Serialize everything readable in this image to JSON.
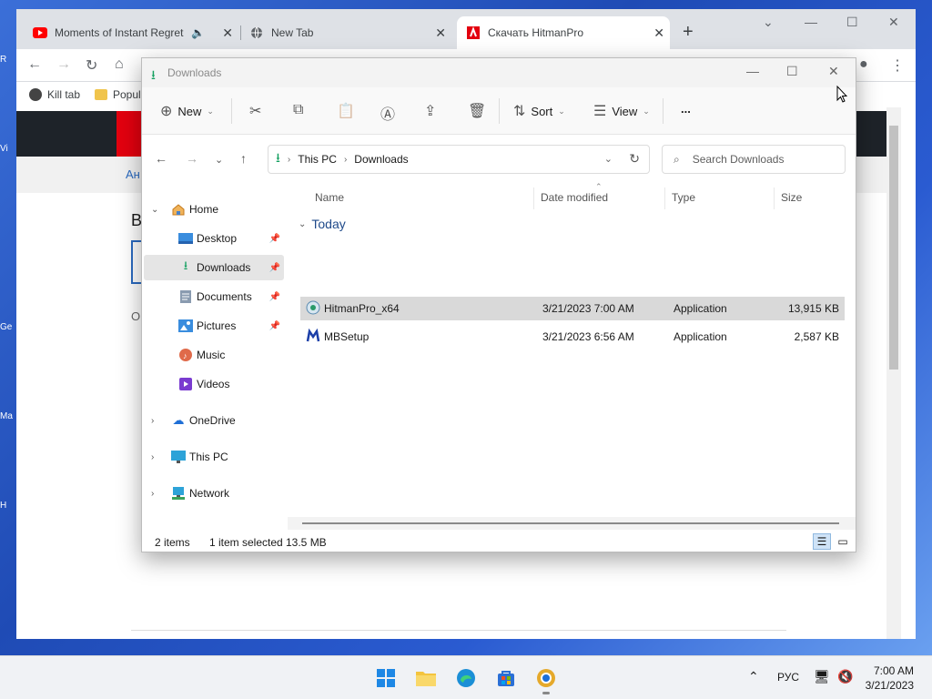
{
  "desktop": {
    "icons": [
      "R",
      "Vi",
      "Ge",
      "Ma",
      "H"
    ]
  },
  "browser": {
    "tabs": [
      {
        "label": "Moments of Instant Regret",
        "icon": "youtube-icon",
        "audio": "speaker-icon"
      },
      {
        "label": "New Tab",
        "icon": "globe-icon"
      },
      {
        "label": "Скачать HitmanPro",
        "icon": "hitmanpro-icon"
      }
    ],
    "bookmarks": [
      {
        "label": "Kill tab"
      },
      {
        "label": "Popul"
      }
    ],
    "page": {
      "nav_fragment": "Ан",
      "heading_fragment": "В",
      "text_fragment": "О"
    }
  },
  "explorer": {
    "title": "Downloads",
    "commands": {
      "new": "New",
      "sort": "Sort",
      "view": "View",
      "more": "..."
    },
    "breadcrumb": [
      "This PC",
      "Downloads"
    ],
    "search_placeholder": "Search Downloads",
    "sidebar": [
      {
        "label": "Home",
        "icon": "home-icon",
        "expandable": true,
        "expanded": true
      },
      {
        "label": "Desktop",
        "icon": "desktop-icon",
        "pinned": true
      },
      {
        "label": "Downloads",
        "icon": "download-icon",
        "pinned": true,
        "selected": true
      },
      {
        "label": "Documents",
        "icon": "documents-icon",
        "pinned": true
      },
      {
        "label": "Pictures",
        "icon": "pictures-icon",
        "pinned": true
      },
      {
        "label": "Music",
        "icon": "music-icon"
      },
      {
        "label": "Videos",
        "icon": "videos-icon"
      },
      {
        "label": "OneDrive",
        "icon": "cloud-icon",
        "expandable": true
      },
      {
        "label": "This PC",
        "icon": "pc-icon",
        "expandable": true
      },
      {
        "label": "Network",
        "icon": "network-icon",
        "expandable": true
      }
    ],
    "columns": [
      "Name",
      "Date modified",
      "Type",
      "Size"
    ],
    "group": "Today",
    "files": [
      {
        "name": "HitmanPro_x64",
        "date": "3/21/2023 7:00 AM",
        "type": "Application",
        "size": "13,915 KB",
        "selected": true
      },
      {
        "name": "MBSetup",
        "date": "3/21/2023 6:56 AM",
        "type": "Application",
        "size": "2,587 KB",
        "selected": false
      }
    ],
    "status": {
      "items": "2 items",
      "selected": "1 item selected",
      "size": "13.5 MB"
    }
  },
  "taskbar": {
    "lang": "РУС",
    "time": "7:00 AM",
    "date": "3/21/2023"
  }
}
